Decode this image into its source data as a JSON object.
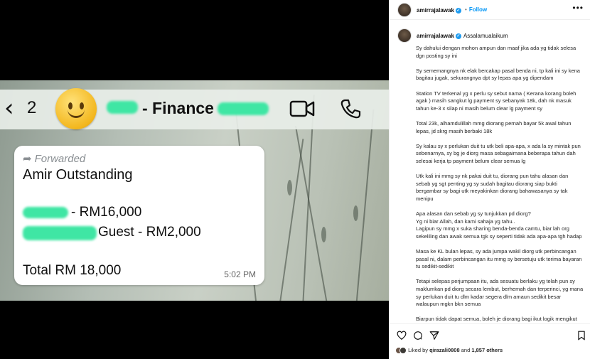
{
  "chat": {
    "back_icon": "chevron-left-icon",
    "unread_count": "2",
    "title_suffix": "- Finance",
    "forwarded_label": "Forwarded",
    "message_title": "Amir Outstanding",
    "line1": "- RM16,000",
    "line2": "Guest - RM2,000",
    "total": "Total RM 18,000",
    "time": "5:02 PM",
    "redaction_color": "#3fe6a4"
  },
  "post": {
    "username": "amirrajalawak",
    "follow_label": "Follow",
    "more_label": "•••",
    "greeting": "Assalamualaikum",
    "paragraphs": [
      "Sy dahului dengan mohon ampun dan maaf jika ada yg tidak selesa dgn posting sy ini",
      "Sy sememangnya nk elak bercakap pasal benda ni, tp kali ini sy kena bagitau jugak, sekurangnya dpt sy lepas apa yg dipendam",
      "Station TV terkenal yg x perlu sy sebut nama ( Kerana korang boleh agak ) masih sangkut lg payment sy sebanyak 18k, dah nk masuk tahun ke-3 x silap ni masih belum clear lg payment sy",
      "Total 23k, alhamdulillah mmg diorang pernah bayar 5k awal tahun lepas, jd skrg masih berbaki 18k",
      "Sy kalau sy x perlukan duit tu utk beli apa-apa, x ada la sy mintak pun sebenarnya, sy bg je diorg masa sebagaimana beberapa tahun dah selesai kerja tp payment belum clear semua lg",
      "Utk kali ini mmg sy nk pakai duit tu, diorang pun tahu alasan dan sebab yg sgt penting yg sy sudah bagitau diorang siap bukti bergambar sy bagi utk meyakinkan diorang bahawasanya sy tak menipu",
      "Apa alasan dan sebab yg sy tunjukkan pd diorg?\nYg ni biar Allah, dan kami sahaja yg tahu..\nLagipun sy mmg x suka sharing benda-benda camtu, biar lah org sekeliling dan awak semua tgk sy seperti tidak ada apa-apa tgh hadap",
      "Masa ke KL bulan lepas, sy ada jumpa wakil diorg utk perbincangan pasal ni, dalam perbincangan itu mmg sy bersetuju utk terima bayaran tu sedikit-sedikit",
      "Tetapi selepas perjumpaan itu, ada sesuatu berlaku yg telah pun sy maklumkan pd diorg secara lembut, berhemah dan terperinci, yg mana sy perlukan duit tu dlm kadar segera dlm amaun sedikit besar walaupun mgkn bkn semua",
      "Biarpun tidak dapat semua, boleh je diorang bagi ikut logik mengikut segala bukti dan sebab yg sy dh bg pd diorang"
    ],
    "likes_prefix": "Liked by",
    "likes_user": "qirazali0808",
    "likes_and": "and",
    "likes_count": "1,857 others"
  }
}
